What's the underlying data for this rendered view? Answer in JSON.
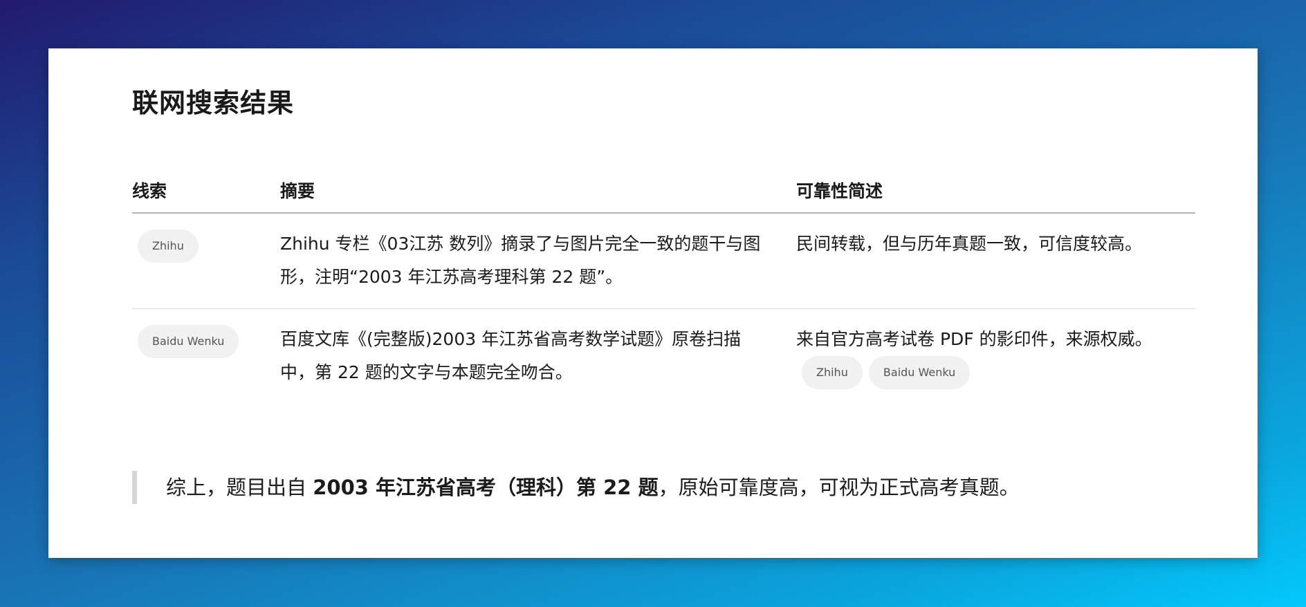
{
  "title": "联网搜索结果",
  "table": {
    "headers": [
      "线索",
      "摘要",
      "可靠性简述"
    ],
    "rows": [
      {
        "source": "Zhihu",
        "summary": "Zhihu 专栏《03江苏 数列》摘录了与图片完全一致的题干与图形，注明“2003 年江苏高考理科第 22 题”。",
        "reliability": "民间转载，但与历年真题一致，可信度较高。",
        "reliability_chips": []
      },
      {
        "source": "Baidu Wenku",
        "summary": "百度文库《(完整版)2003 年江苏省高考数学试题》原卷扫描中，第 22 题的文字与本题完全吻合。",
        "reliability": "来自官方高考试卷 PDF 的影印件，来源权威。",
        "reliability_chips": [
          "Zhihu",
          "Baidu Wenku"
        ]
      }
    ]
  },
  "conclusion": {
    "prefix": "综上，题目出自 ",
    "bold": "2003 年江苏省高考（理科）第 22 题",
    "suffix": "，原始可靠度高，可视为正式高考真题。"
  },
  "colors": {
    "background_gradient": [
      "#221a6e",
      "#1b4b97",
      "#1973b4",
      "#0aa6de",
      "#03c8fb"
    ],
    "card": "#ffffff",
    "chip_bg": "#f1f1f1",
    "quote_bar": "#d6d6d6"
  }
}
